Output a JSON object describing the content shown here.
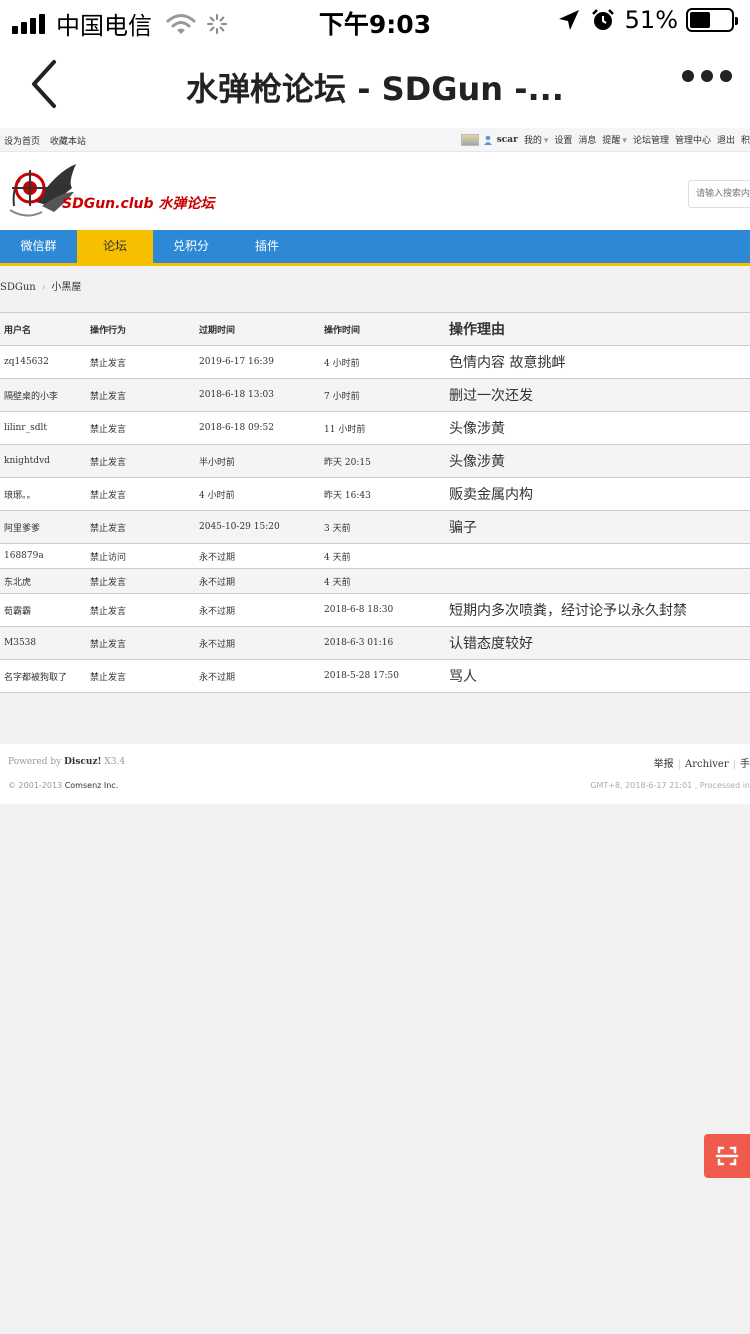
{
  "status_bar": {
    "carrier": "中国电信",
    "time": "下午9:03",
    "battery_percent_text": "51%",
    "battery_level": 0.51
  },
  "nav_bar": {
    "title": "水弹枪论坛 - SDGun -..."
  },
  "toolbar": {
    "left_links": [
      "设为首页",
      "收藏本站"
    ],
    "username": "scar",
    "right_links": [
      "我的",
      "设置",
      "消息",
      "提醒",
      "论坛管理",
      "管理中心",
      "退出",
      "积"
    ]
  },
  "header": {
    "logo_text": "SDGun.club 水弹论坛",
    "search_placeholder": "请输入搜索内容"
  },
  "main_nav": {
    "items": [
      "微信群",
      "论坛",
      "兑积分",
      "插件"
    ],
    "active_index": 1
  },
  "breadcrumb": {
    "items": [
      "SDGun",
      "小黑屋"
    ]
  },
  "table": {
    "headers": [
      "用户名",
      "操作行为",
      "过期时间",
      "操作时间",
      "操作理由"
    ],
    "rows": [
      {
        "user": "zq145632",
        "action": "禁止发言",
        "expire": "2019-6-17 16:39",
        "time": "4 小时前",
        "reason": "色情内容 故意挑衅"
      },
      {
        "user": "隔壁桌的小李",
        "action": "禁止发言",
        "expire": "2018-6-18 13:03",
        "time": "7 小时前",
        "reason": "删过一次还发"
      },
      {
        "user": "lilinr_sdlt",
        "action": "禁止发言",
        "expire": "2018-6-18 09:52",
        "time": "11 小时前",
        "reason": "头像涉黄"
      },
      {
        "user": "knightdvd",
        "action": "禁止发言",
        "expire": "半小时前",
        "time": "昨天 20:15",
        "reason": "头像涉黄"
      },
      {
        "user": "琅琊。。",
        "action": "禁止发言",
        "expire": "4 小时前",
        "time": "昨天 16:43",
        "reason": "贩卖金属内构"
      },
      {
        "user": "阿里爹爹",
        "action": "禁止发言",
        "expire": "2045-10-29 15:20",
        "time": "3 天前",
        "reason": "骗子"
      },
      {
        "user": "168879a",
        "action": "禁止访问",
        "expire": "永不过期",
        "time": "4 天前",
        "reason": ""
      },
      {
        "user": "东北虎",
        "action": "禁止发言",
        "expire": "永不过期",
        "time": "4 天前",
        "reason": ""
      },
      {
        "user": "荀霸霸",
        "action": "禁止发言",
        "expire": "永不过期",
        "time": "2018-6-8 18:30",
        "reason": "短期内多次喷粪，经讨论予以永久封禁"
      },
      {
        "user": "M3538",
        "action": "禁止发言",
        "expire": "永不过期",
        "time": "2018-6-3 01:16",
        "reason": "认错态度较好"
      },
      {
        "user": "名字都被狗取了",
        "action": "禁止发言",
        "expire": "永不过期",
        "time": "2018-5-28 17:50",
        "reason": "骂人"
      }
    ]
  },
  "footer": {
    "powered_prefix": "Powered by",
    "powered_name": "Discuz!",
    "powered_version": "X3.4",
    "copyright_prefix": "© 2001-2013",
    "copyright_company": "Comsenz Inc.",
    "links": [
      "举报",
      "Archiver",
      "手"
    ],
    "gmt": "GMT+8, 2018-6-17 21:01 , Processed in"
  },
  "colors": {
    "nav_blue": "#2d89d6",
    "nav_yellow": "#f6c000",
    "float_red": "#f05a4d"
  }
}
